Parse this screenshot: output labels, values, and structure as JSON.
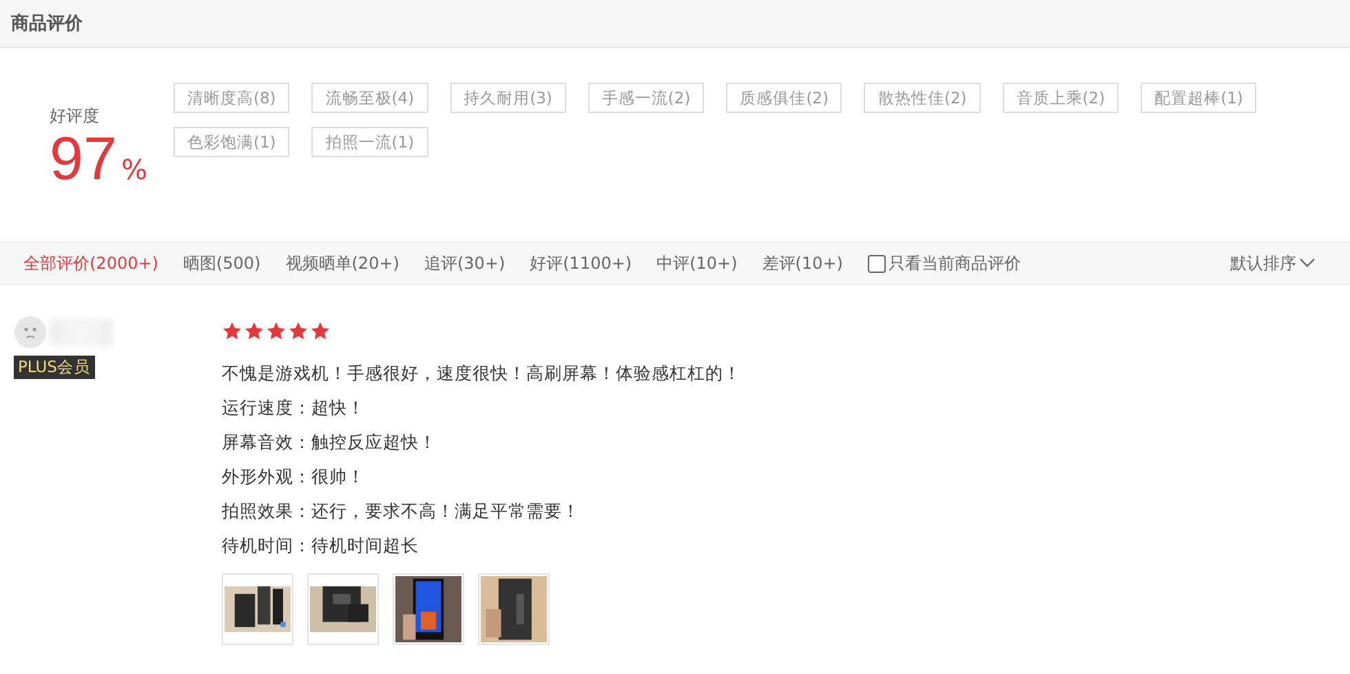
{
  "section_title": "商品评价",
  "summary": {
    "label": "好评度",
    "rate": "97",
    "unit": "%"
  },
  "tags": [
    "清晰度高(8)",
    "流畅至极(4)",
    "持久耐用(3)",
    "手感一流(2)",
    "质感俱佳(2)",
    "散热性佳(2)",
    "音质上乘(2)",
    "配置超棒(1)",
    "色彩饱满(1)",
    "拍照一流(1)"
  ],
  "filters": [
    {
      "label": "全部评价(2000+)",
      "selected": true
    },
    {
      "label": "晒图(500)",
      "selected": false
    },
    {
      "label": "视频晒单(20+)",
      "selected": false
    },
    {
      "label": "追评(30+)",
      "selected": false
    },
    {
      "label": "好评(1100+)",
      "selected": false
    },
    {
      "label": "中评(10+)",
      "selected": false
    },
    {
      "label": "差评(10+)",
      "selected": false
    }
  ],
  "only_current": {
    "label": "只看当前商品评价",
    "checked": false
  },
  "sort": {
    "label": "默认排序"
  },
  "review": {
    "badge": "PLUS会员",
    "stars": 5,
    "lines": [
      "不愧是游戏机！手感很好，速度很快！高刷屏幕！体验感杠杠的！",
      "运行速度：超快！",
      "屏幕音效：触控反应超快！",
      "外形外观：很帅！",
      "拍照效果：还行，要求不高！满足平常需要！",
      "待机时间：待机时间超长"
    ],
    "photos": [
      {
        "kind": "picture"
      },
      {
        "kind": "picture"
      },
      {
        "kind": "picture"
      },
      {
        "kind": "picture"
      }
    ]
  }
}
